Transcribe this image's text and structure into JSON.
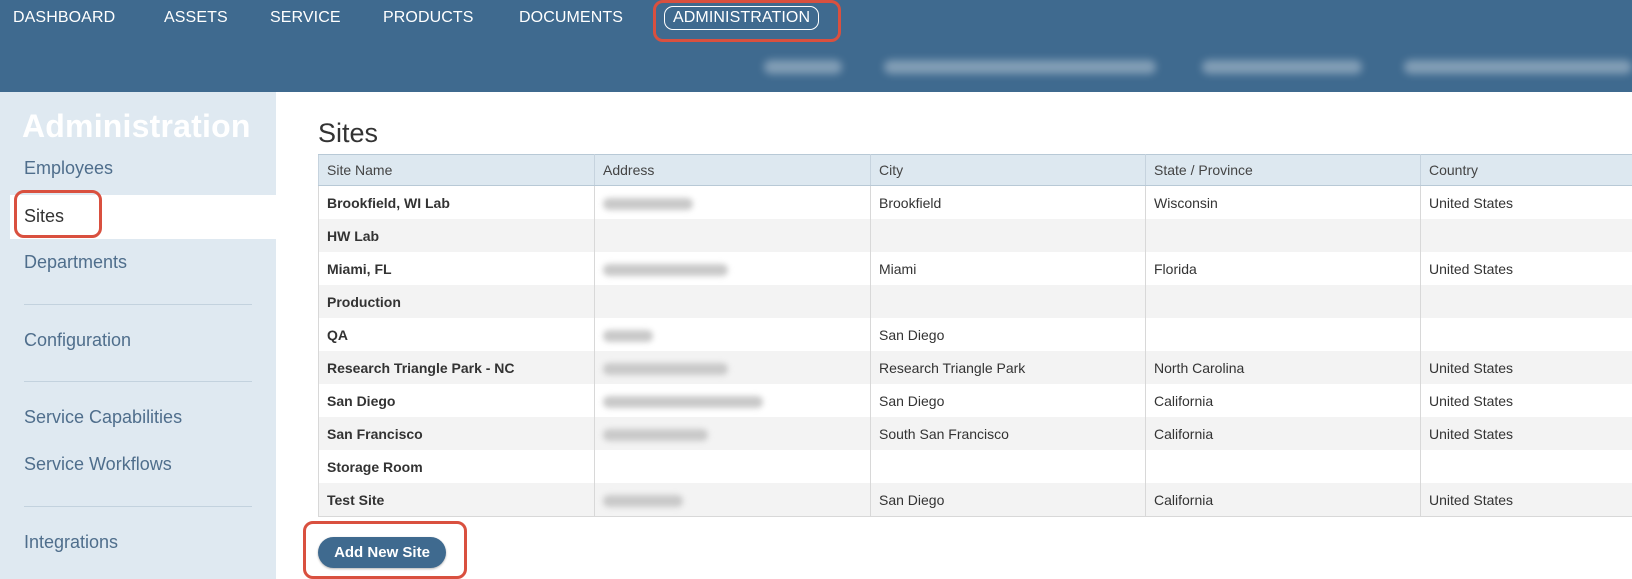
{
  "top_nav": {
    "items": [
      "DASHBOARD",
      "ASSETS",
      "SERVICE",
      "PRODUCTS",
      "DOCUMENTS",
      "ADMINISTRATION"
    ],
    "active": "ADMINISTRATION"
  },
  "sidebar": {
    "title": "Administration",
    "items": [
      "Employees",
      "Sites",
      "Departments",
      "Configuration",
      "Service Capabilities",
      "Service Workflows",
      "Integrations"
    ],
    "active": "Sites"
  },
  "main": {
    "title": "Sites",
    "columns": [
      "Site Name",
      "Address",
      "City",
      "State / Province",
      "Country"
    ],
    "rows": [
      {
        "site": "Brookfield, WI Lab",
        "city": "Brookfield",
        "state": "Wisconsin",
        "country": "United States",
        "address_redacted": true
      },
      {
        "site": "HW Lab",
        "city": "",
        "state": "",
        "country": "",
        "address_redacted": false
      },
      {
        "site": "Miami, FL",
        "city": "Miami",
        "state": "Florida",
        "country": "United States",
        "address_redacted": true
      },
      {
        "site": "Production",
        "city": "",
        "state": "",
        "country": "",
        "address_redacted": false
      },
      {
        "site": "QA",
        "city": "San Diego",
        "state": "",
        "country": "",
        "address_redacted": true
      },
      {
        "site": "Research Triangle Park - NC",
        "city": "Research Triangle Park",
        "state": "North Carolina",
        "country": "United States",
        "address_redacted": true
      },
      {
        "site": "San Diego",
        "city": "San Diego",
        "state": "California",
        "country": "United States",
        "address_redacted": true
      },
      {
        "site": "San Francisco",
        "city": "South San Francisco",
        "state": "California",
        "country": "United States",
        "address_redacted": true
      },
      {
        "site": "Storage Room",
        "city": "",
        "state": "",
        "country": "",
        "address_redacted": false
      },
      {
        "site": "Test Site",
        "city": "San Diego",
        "state": "California",
        "country": "United States",
        "address_redacted": true
      }
    ],
    "add_button_label": "Add New Site"
  },
  "colors": {
    "header_bg": "#3f6a8f",
    "sidebar_bg": "#dfe9f1",
    "highlight": "#d9503f",
    "link": "#466b8e"
  }
}
